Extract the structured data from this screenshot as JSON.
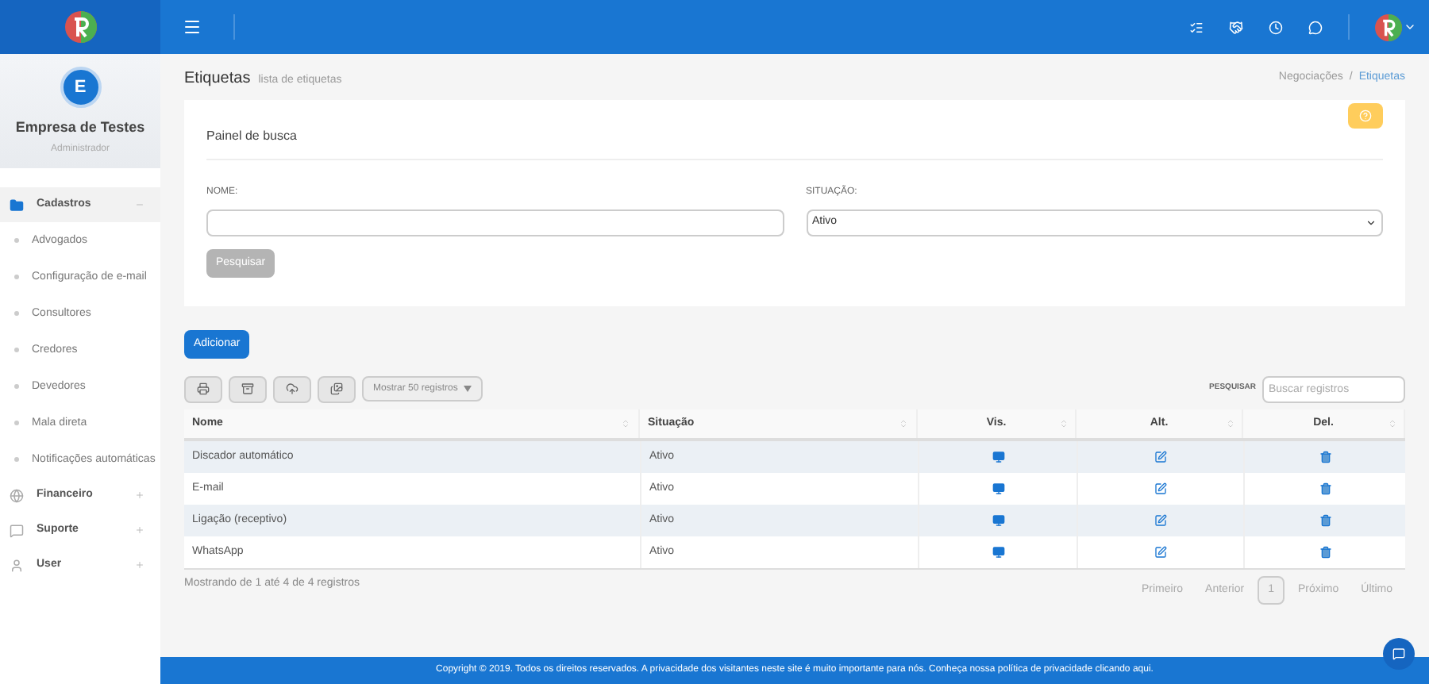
{
  "sidebar": {
    "avatar_letter": "E",
    "company": "Empresa de Testes",
    "role": "Administrador",
    "menu": [
      {
        "label": "Cadastros",
        "expanded": true,
        "selected": true,
        "children": [
          {
            "label": "Advogados"
          },
          {
            "label": "Configuração de e-mail"
          },
          {
            "label": "Consultores"
          },
          {
            "label": "Credores"
          },
          {
            "label": "Devedores"
          },
          {
            "label": "Mala direta"
          },
          {
            "label": "Notificações automáticas"
          }
        ]
      },
      {
        "label": "Financeiro",
        "expanded": false,
        "selected": false
      },
      {
        "label": "Suporte",
        "expanded": false,
        "selected": false
      },
      {
        "label": "User",
        "expanded": false,
        "selected": false
      }
    ]
  },
  "page": {
    "title": "Etiquetas",
    "subtitle": "lista de etiquetas",
    "breadcrumb": [
      "Negociações",
      "Etiquetas"
    ],
    "breadcrumb_separator": "/"
  },
  "search_panel": {
    "title": "Painel de busca",
    "fields": [
      {
        "label": "NOME:",
        "kind": "text"
      },
      {
        "label": "SITUAÇÃO:",
        "kind": "select",
        "value": "Ativo"
      }
    ],
    "button": {
      "label": "Pesquisar",
      "disabled": true
    }
  },
  "add_button": "Adicionar",
  "toolbar": {
    "page_size": "Mostrar 50 registros",
    "search_label": "PESQUISAR",
    "search_placeholder": "Buscar registros"
  },
  "table": {
    "columns": [
      "Nome",
      "Situação",
      "Vis.",
      "Alt.",
      "Del."
    ],
    "rows": [
      {
        "name": "Discador automático",
        "status": "Ativo"
      },
      {
        "name": "E-mail",
        "status": "Ativo"
      },
      {
        "name": "Ligação (receptivo)",
        "status": "Ativo"
      },
      {
        "name": "WhatsApp",
        "status": "Ativo"
      }
    ]
  },
  "info": "Mostrando de 1 até 4 de 4 registros",
  "pagination": [
    {
      "label": "Primeiro",
      "selected": false
    },
    {
      "label": "Anterior",
      "selected": false
    },
    {
      "label": "1",
      "selected": true
    },
    {
      "label": "Próximo",
      "selected": false
    },
    {
      "label": "Último",
      "selected": false
    }
  ],
  "footer": "Copyright © 2019. Todos os direitos reservados. A privacidade dos visitantes neste site é muito importante para nós. Conheça nossa política de privacidade clicando aqui."
}
